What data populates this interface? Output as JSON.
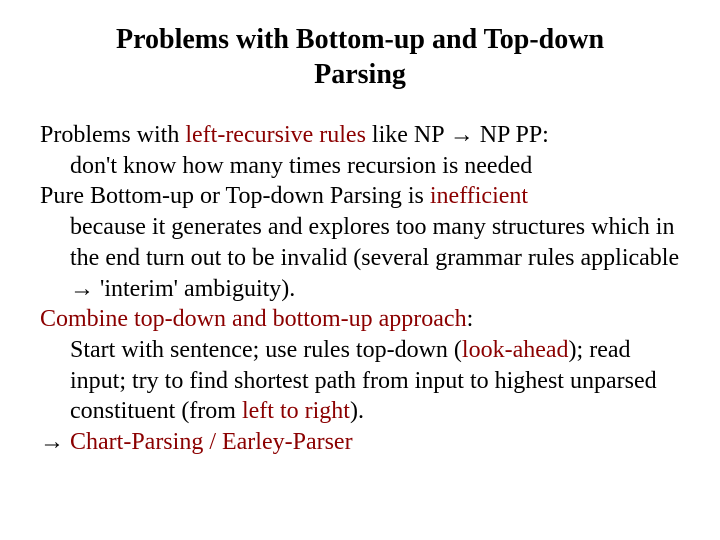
{
  "title": "Problems with Bottom-up and Top-down Parsing",
  "p1": {
    "t1": "Problems with ",
    "hl1": "left-recursive rules",
    "t2": " like NP → NP PP:",
    "line2": "don't know how many times recursion is needed"
  },
  "p2": {
    "t1": "Pure Bottom-up or Top-down Parsing is ",
    "hl1": "inefficient",
    "line2": "because it generates and explores too many structures which in the end turn out to be invalid (several grammar rules applicable → 'interim' ambiguity)."
  },
  "p3": {
    "hl1": "Combine top-down and bottom-up approach",
    "t1": ":",
    "l2a": "Start with sentence; use rules top-down (",
    "hl2": "look-ahead",
    "l2b": "); read input; try to find shortest path from input to highest unparsed constituent (from ",
    "hl3": "left to right",
    "l2c": ")."
  },
  "p4": {
    "t1": "→ ",
    "hl1": "Chart-Parsing / Earley-Parser"
  }
}
